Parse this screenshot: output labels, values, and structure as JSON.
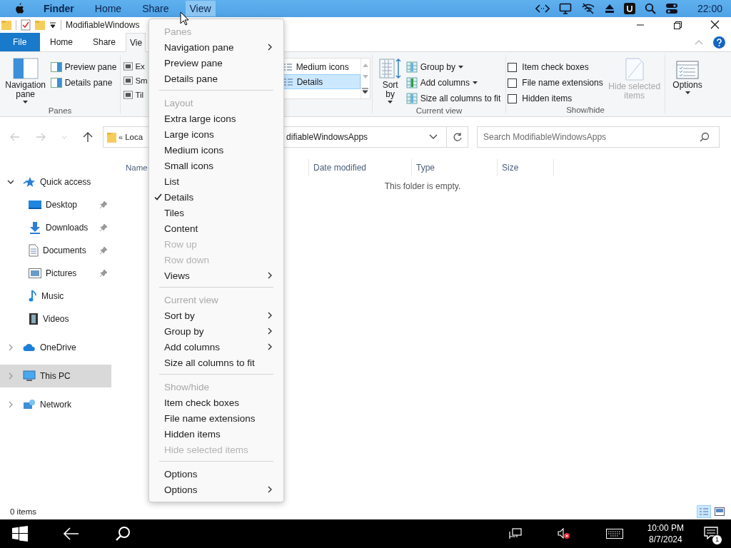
{
  "menubar": {
    "items": [
      {
        "label": "Finder",
        "selected": false
      },
      {
        "label": "Home",
        "selected": false
      },
      {
        "label": "Share",
        "selected": false
      },
      {
        "label": "View",
        "selected": true
      }
    ],
    "clock": "22:00"
  },
  "window": {
    "title": "ModifiableWindows"
  },
  "ribbon_tabs": [
    {
      "label": "File",
      "kind": "file",
      "selected": false
    },
    {
      "label": "Home",
      "kind": "tab",
      "selected": false
    },
    {
      "label": "Share",
      "kind": "tab",
      "selected": false
    },
    {
      "label": "Vie",
      "kind": "tab",
      "selected": true
    }
  ],
  "ribbon": {
    "panes": {
      "label": "Panes",
      "navigation_pane": "Navigation pane",
      "items": [
        "Preview pane",
        "Details pane"
      ]
    },
    "layout": {
      "left_items": [
        {
          "label": "Ex",
          "selected": false
        },
        {
          "label": "Sm",
          "selected": false
        },
        {
          "label": "Til",
          "selected": false
        }
      ],
      "right_items": [
        {
          "label": "Medium icons",
          "selected": false
        },
        {
          "label": "Details",
          "selected": true
        }
      ]
    },
    "current_view": {
      "label": "Current view",
      "sort_by": "Sort by",
      "items": [
        {
          "label": "Group by",
          "dropdown": true
        },
        {
          "label": "Add columns",
          "dropdown": true
        },
        {
          "label": "Size all columns to fit",
          "dropdown": false
        }
      ]
    },
    "show_hide": {
      "label": "Show/hide",
      "checkboxes": [
        {
          "label": "Item check boxes",
          "checked": false
        },
        {
          "label": "File name extensions",
          "checked": false
        },
        {
          "label": "Hidden items",
          "checked": false
        }
      ],
      "hide_selected": {
        "label": "Hide selected items",
        "disabled": true
      }
    },
    "options": "Options"
  },
  "address": {
    "separator": "«",
    "crumb_left": "Loca",
    "crumb_right": "difiableWindowsApps"
  },
  "search": {
    "placeholder": "Search ModifiableWindowsApps"
  },
  "sidebar": {
    "items": [
      {
        "label": "Quick access",
        "expanded": true,
        "selected": false,
        "children": [
          {
            "label": "Desktop",
            "pinned": true
          },
          {
            "label": "Downloads",
            "pinned": true
          },
          {
            "label": "Documents",
            "pinned": true
          },
          {
            "label": "Pictures",
            "pinned": true
          },
          {
            "label": "Music",
            "pinned": false
          },
          {
            "label": "Videos",
            "pinned": false
          }
        ]
      },
      {
        "label": "OneDrive",
        "expanded": false,
        "selected": false
      },
      {
        "label": "This PC",
        "expanded": false,
        "selected": true
      },
      {
        "label": "Network",
        "expanded": false,
        "selected": false
      }
    ]
  },
  "table": {
    "columns": [
      "Name",
      "Date modified",
      "Type",
      "Size"
    ],
    "empty_message": "This folder is empty."
  },
  "status_bar": {
    "items_count": "0 items",
    "views": [
      {
        "selected": true
      },
      {
        "selected": false
      }
    ]
  },
  "context_menu": {
    "sections": [
      {
        "header": "Panes",
        "items": [
          {
            "label": "Navigation pane",
            "checked": false,
            "disabled": false,
            "submenu": true
          },
          {
            "label": "Preview pane",
            "checked": false,
            "disabled": false,
            "submenu": false
          },
          {
            "label": "Details pane",
            "checked": false,
            "disabled": false,
            "submenu": false
          }
        ]
      },
      {
        "header": "Layout",
        "items": [
          {
            "label": "Extra large icons",
            "checked": false,
            "disabled": false,
            "submenu": false
          },
          {
            "label": "Large icons",
            "checked": false,
            "disabled": false,
            "submenu": false
          },
          {
            "label": "Medium icons",
            "checked": false,
            "disabled": false,
            "submenu": false
          },
          {
            "label": "Small icons",
            "checked": false,
            "disabled": false,
            "submenu": false
          },
          {
            "label": "List",
            "checked": false,
            "disabled": false,
            "submenu": false
          },
          {
            "label": "Details",
            "checked": true,
            "disabled": false,
            "submenu": false
          },
          {
            "label": "Tiles",
            "checked": false,
            "disabled": false,
            "submenu": false
          },
          {
            "label": "Content",
            "checked": false,
            "disabled": false,
            "submenu": false
          },
          {
            "label": "Row up",
            "checked": false,
            "disabled": true,
            "submenu": false
          },
          {
            "label": "Row down",
            "checked": false,
            "disabled": true,
            "submenu": false
          },
          {
            "label": "Views",
            "checked": false,
            "disabled": false,
            "submenu": true
          }
        ]
      },
      {
        "header": "Current view",
        "items": [
          {
            "label": "Sort by",
            "checked": false,
            "disabled": false,
            "submenu": true
          },
          {
            "label": "Group by",
            "checked": false,
            "disabled": false,
            "submenu": true
          },
          {
            "label": "Add columns",
            "checked": false,
            "disabled": false,
            "submenu": true
          },
          {
            "label": "Size all columns to fit",
            "checked": false,
            "disabled": false,
            "submenu": false
          }
        ]
      },
      {
        "header": "Show/hide",
        "items": [
          {
            "label": "Item check boxes",
            "checked": false,
            "disabled": false,
            "submenu": false
          },
          {
            "label": "File name extensions",
            "checked": false,
            "disabled": false,
            "submenu": false
          },
          {
            "label": "Hidden items",
            "checked": false,
            "disabled": false,
            "submenu": false
          },
          {
            "label": "Hide selected items",
            "checked": false,
            "disabled": true,
            "submenu": false
          }
        ]
      },
      {
        "items": [
          {
            "label": "Options",
            "checked": false,
            "disabled": false,
            "submenu": false
          },
          {
            "label": "Options",
            "checked": false,
            "disabled": false,
            "submenu": true
          }
        ]
      }
    ]
  },
  "taskbar": {
    "time": "10:00 PM",
    "date": "8/7/2024",
    "notifications": "1"
  }
}
